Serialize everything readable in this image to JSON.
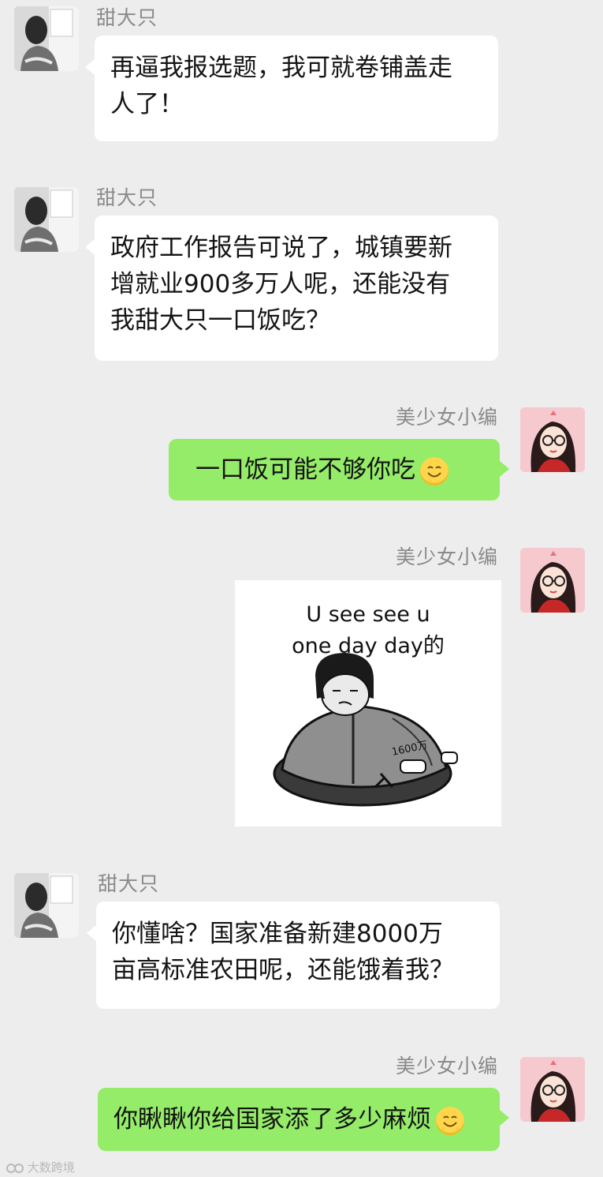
{
  "contacts": {
    "left_name": "甜大只",
    "right_name": "美少女小编"
  },
  "messages": [
    {
      "sender": "甜大只",
      "side": "left",
      "type": "text",
      "lines": [
        "再逼我报选题，我可就卷铺盖走",
        "人了！"
      ]
    },
    {
      "sender": "甜大只",
      "side": "left",
      "type": "text",
      "lines": [
        "政府工作报告可说了，城镇要新",
        "增就业900多万人呢，还能没有",
        "我甜大只一口饭吃？"
      ]
    },
    {
      "sender": "美少女小编",
      "side": "right",
      "type": "text",
      "lines": [
        "一口饭可能不够你吃"
      ],
      "emoji": "smile-emoji"
    },
    {
      "sender": "美少女小编",
      "side": "right",
      "type": "sticker",
      "caption_lines": [
        "U see see u",
        "one day day的"
      ],
      "label": "1600万"
    },
    {
      "sender": "甜大只",
      "side": "left",
      "type": "text",
      "lines": [
        "你懂啥？国家准备新建8000万",
        "亩高标准农田呢，还能饿着我？"
      ]
    },
    {
      "sender": "美少女小编",
      "side": "right",
      "type": "text",
      "lines": [
        "你瞅瞅你给国家添了多少麻烦"
      ],
      "emoji": "smile-emoji"
    }
  ],
  "watermark": "大数跨境",
  "colors": {
    "background": "#ededed",
    "incoming_bubble": "#ffffff",
    "outgoing_bubble": "#95ec69",
    "name_text": "#8a8a8a"
  }
}
